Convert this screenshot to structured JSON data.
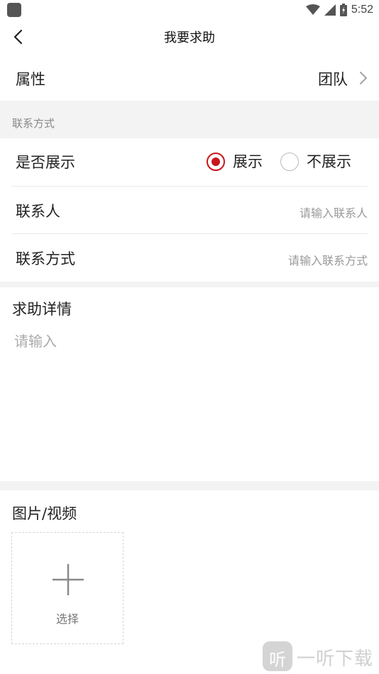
{
  "status_bar": {
    "time": "5:52",
    "icons": [
      "app-icon",
      "wifi-icon",
      "signal-icon",
      "battery-icon"
    ]
  },
  "header": {
    "title": "我要求助",
    "back_icon": "back-arrow-icon"
  },
  "attribute": {
    "label": "属性",
    "value": "团队",
    "chevron_icon": "chevron-right-icon"
  },
  "contact_section": {
    "title": "联系方式",
    "show_row": {
      "label": "是否展示",
      "options": [
        {
          "label": "展示",
          "selected": true
        },
        {
          "label": "不展示",
          "selected": false
        }
      ]
    },
    "contact_person": {
      "label": "联系人",
      "placeholder": "请输入联系人"
    },
    "contact_method": {
      "label": "联系方式",
      "placeholder": "请输入联系方式"
    }
  },
  "details": {
    "title": "求助详情",
    "placeholder": "请输入"
  },
  "media": {
    "title": "图片/视频",
    "upload_label": "选择",
    "upload_icon": "plus-icon"
  },
  "watermark": {
    "icon_char": "听",
    "text": "一听下载"
  },
  "colors": {
    "accent": "#c8161d",
    "background_gray": "#f3f3f3",
    "placeholder": "#999999"
  }
}
